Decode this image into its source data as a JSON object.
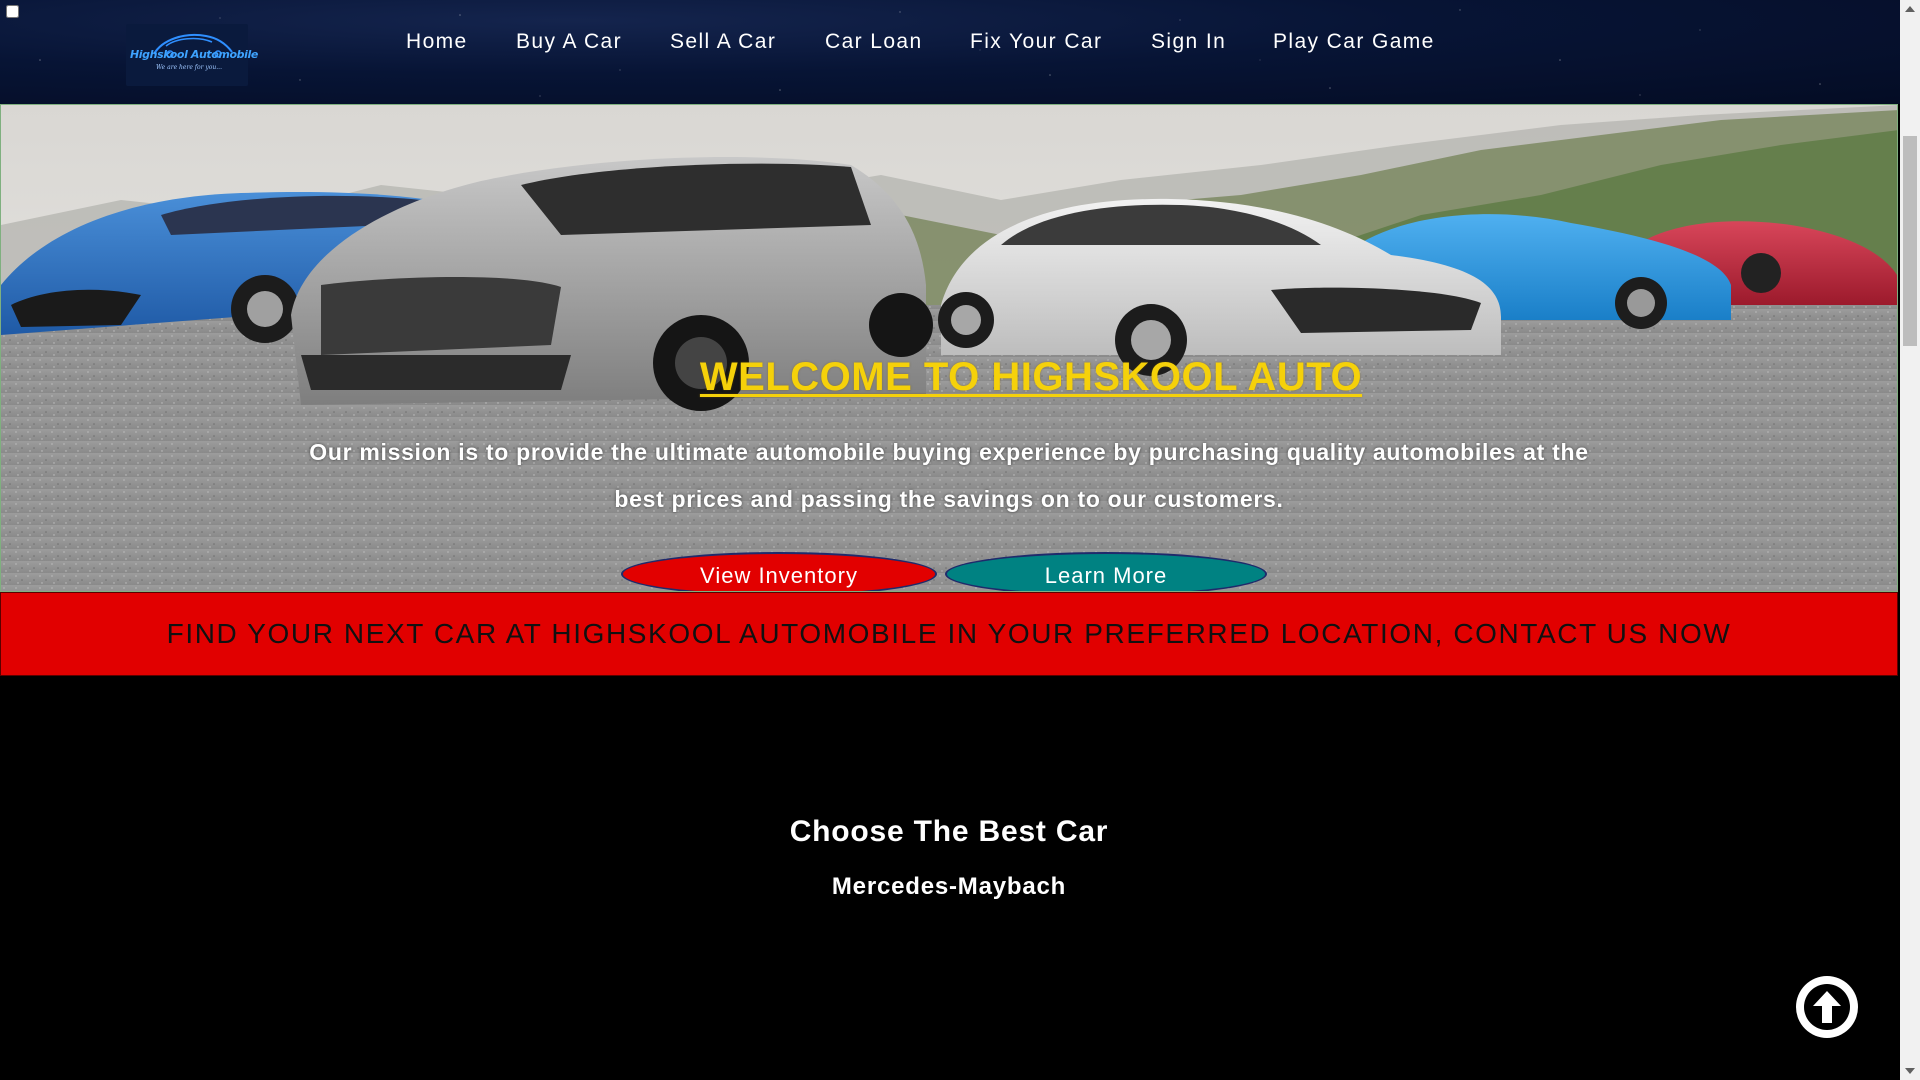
{
  "logo": {
    "name": "Highskool Automobile",
    "tagline": "We are here for you..."
  },
  "nav": {
    "items": [
      {
        "label": "Home"
      },
      {
        "label": "Buy A Car"
      },
      {
        "label": "Sell A Car"
      },
      {
        "label": "Car Loan"
      },
      {
        "label": "Fix Your Car"
      },
      {
        "label": "Sign In"
      },
      {
        "label": "Play Car Game"
      }
    ]
  },
  "hero": {
    "title": "WELCOME TO HIGHSKOOL AUTO",
    "mission": "Our mission is to provide the ultimate automobile buying experience by purchasing quality automobiles at the best prices and passing the savings on to our customers.",
    "view_inventory_label": "View Inventory",
    "learn_more_label": "Learn More"
  },
  "banner": {
    "text": "FIND YOUR NEXT CAR AT HIGHSKOOL AUTOMOBILE IN YOUR PREFERRED LOCATION, CONTACT US NOW"
  },
  "choose": {
    "title": "Choose The Best Car",
    "subtitle": "Mercedes-Maybach"
  },
  "colors": {
    "nav_background": "#071435",
    "hero_title": "#f5d10a",
    "view_inventory_button": "#e20000",
    "learn_more_button": "#008282",
    "banner_background": "#e10000",
    "page_background": "#000000"
  },
  "icons": {
    "back_to_top": "arrow-up-circle-icon",
    "logo_car": "car-outline-icon"
  }
}
